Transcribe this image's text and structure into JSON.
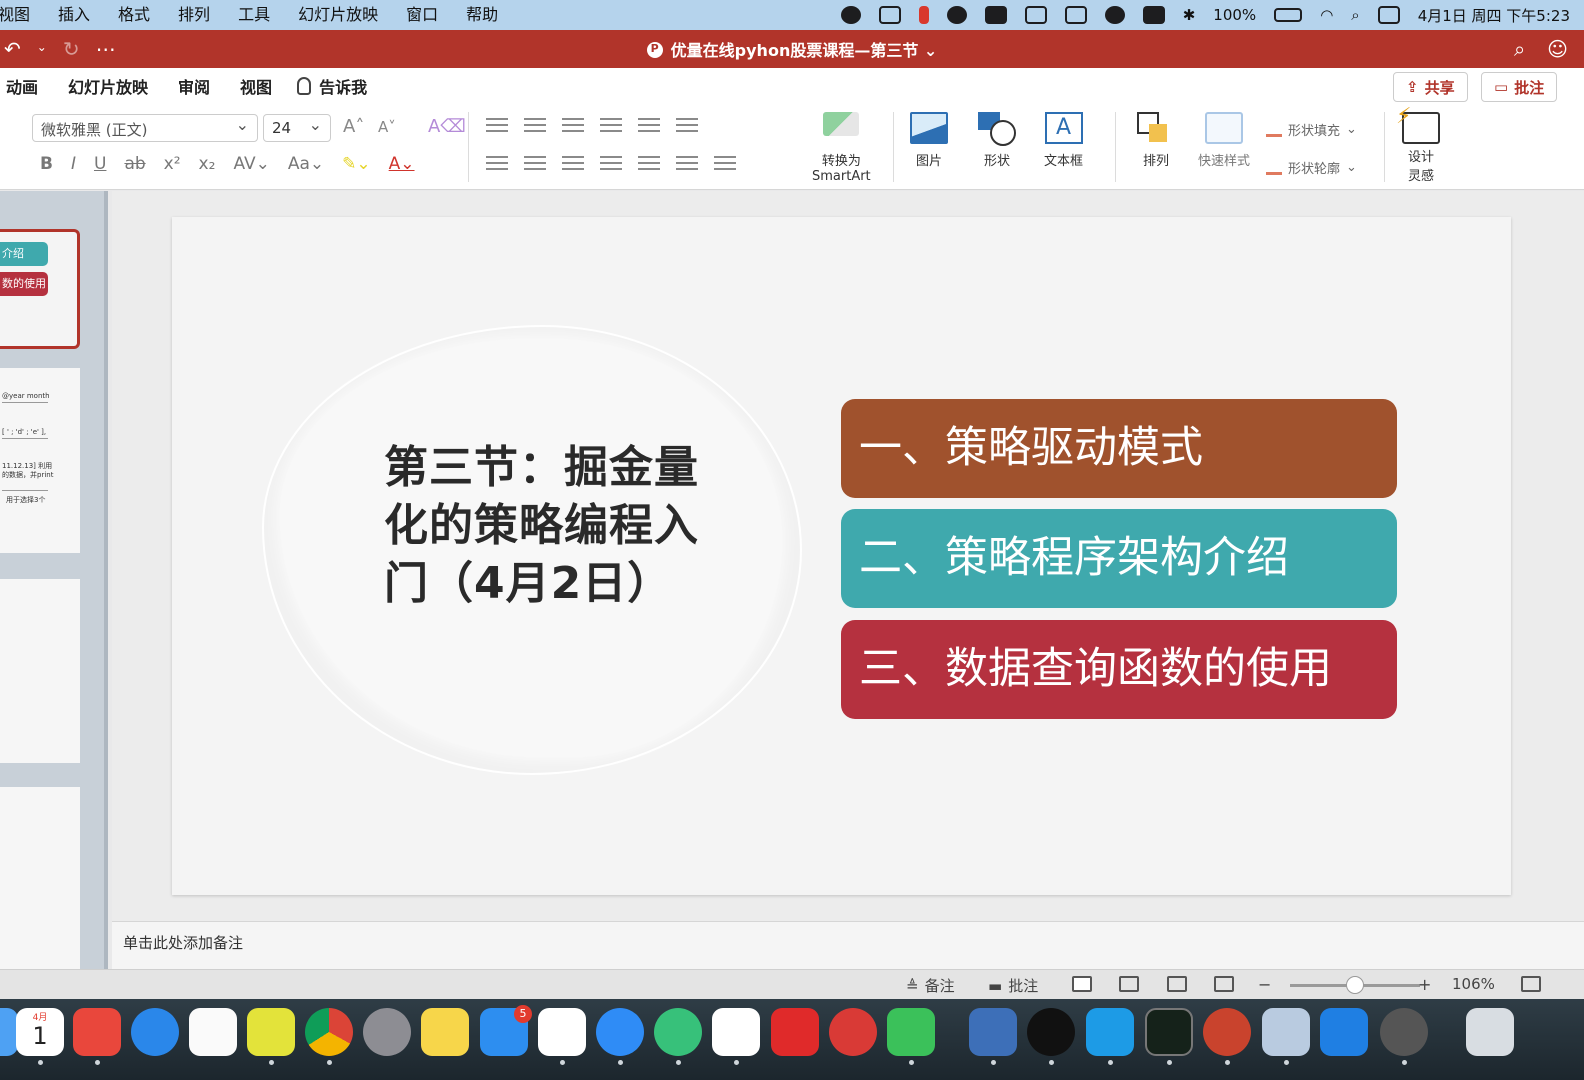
{
  "menubar": {
    "menus": [
      "视图",
      "插入",
      "格式",
      "排列",
      "工具",
      "幻灯片放映",
      "窗口",
      "帮助"
    ],
    "battery": "100%",
    "datetime": "4月1日 周四 下午5:23",
    "status_icons": [
      "wechat-icon",
      "mail-icon",
      "parallels-icon",
      "shield-icon",
      "keyboard-icon",
      "wifi-signal-icon",
      "screen-icon",
      "bell-icon",
      "s-icon",
      "bluetooth-icon",
      "battery-icon",
      "wifi-icon",
      "search-icon",
      "control-center-icon"
    ]
  },
  "titlebar": {
    "title": "优量在线pyhon股票课程—第三节",
    "bg_color": "#b1342a"
  },
  "ribbon_tabs": {
    "tabs": [
      "动画",
      "幻灯片放映",
      "审阅",
      "视图"
    ],
    "tell_me": "告诉我",
    "share": "共享",
    "comments": "批注"
  },
  "ribbon": {
    "font_name": "微软雅黑 (正文)",
    "font_size": "24",
    "convert_label": "转换为",
    "smartart_label": "SmartArt",
    "picture": "图片",
    "shape": "形状",
    "textbox": "文本框",
    "textbox_glyph": "A",
    "arrange": "排列",
    "quick_styles": "快速样式",
    "shape_fill": "形状填充",
    "shape_outline": "形状轮廓",
    "design_ideas_1": "设计",
    "design_ideas_2": "灵感"
  },
  "thumbnails": {
    "pill_1": "介绍",
    "pill_2": "数的使用",
    "line_1": "@year month",
    "line_2": "[ ' ; 'd' ; 'e' ],",
    "line_3": "11.12.13] 利用",
    "line_4": "的数据，并print",
    "line_5": "用于选择3个"
  },
  "slide": {
    "title": "第三节：掘金量化的策略编程入门（4月2日）",
    "items": [
      {
        "label": "一、策略驱动模式",
        "color": "#a0522d"
      },
      {
        "label": "二、策略程序架构介绍",
        "color": "#3fa9ad"
      },
      {
        "label": "三、数据查询函数的使用",
        "color": "#b5313f"
      }
    ]
  },
  "notes_placeholder": "单击此处添加备注",
  "statusbar": {
    "notes": "备注",
    "comments": "批注",
    "zoom_minus": "−",
    "zoom_plus": "+",
    "zoom": "106%",
    "zoom_fraction": 0.5
  },
  "dock": {
    "calendar_month": "4月",
    "calendar_day": "1",
    "appstore_badge": "5",
    "apps": [
      "finder-icon",
      "calendar-icon",
      "mail-app-icon",
      "kugou-icon",
      "reminders-icon",
      "pycharm-icon",
      "chrome-icon",
      "system-preferences-icon",
      "notes-icon",
      "app-store-icon",
      "shield-app-icon",
      "dingtalk-icon",
      "video-icon",
      "baidu-netdisk-icon",
      "youdao-icon",
      "remote-desktop-icon",
      "wechat-app-icon",
      "parallels-app-icon",
      "qq-icon",
      "s5-icon",
      "activity-monitor-icon",
      "powerpoint-icon",
      "preview-icon",
      "windows-icon",
      "quicktime-icon",
      "trash-icon"
    ]
  }
}
